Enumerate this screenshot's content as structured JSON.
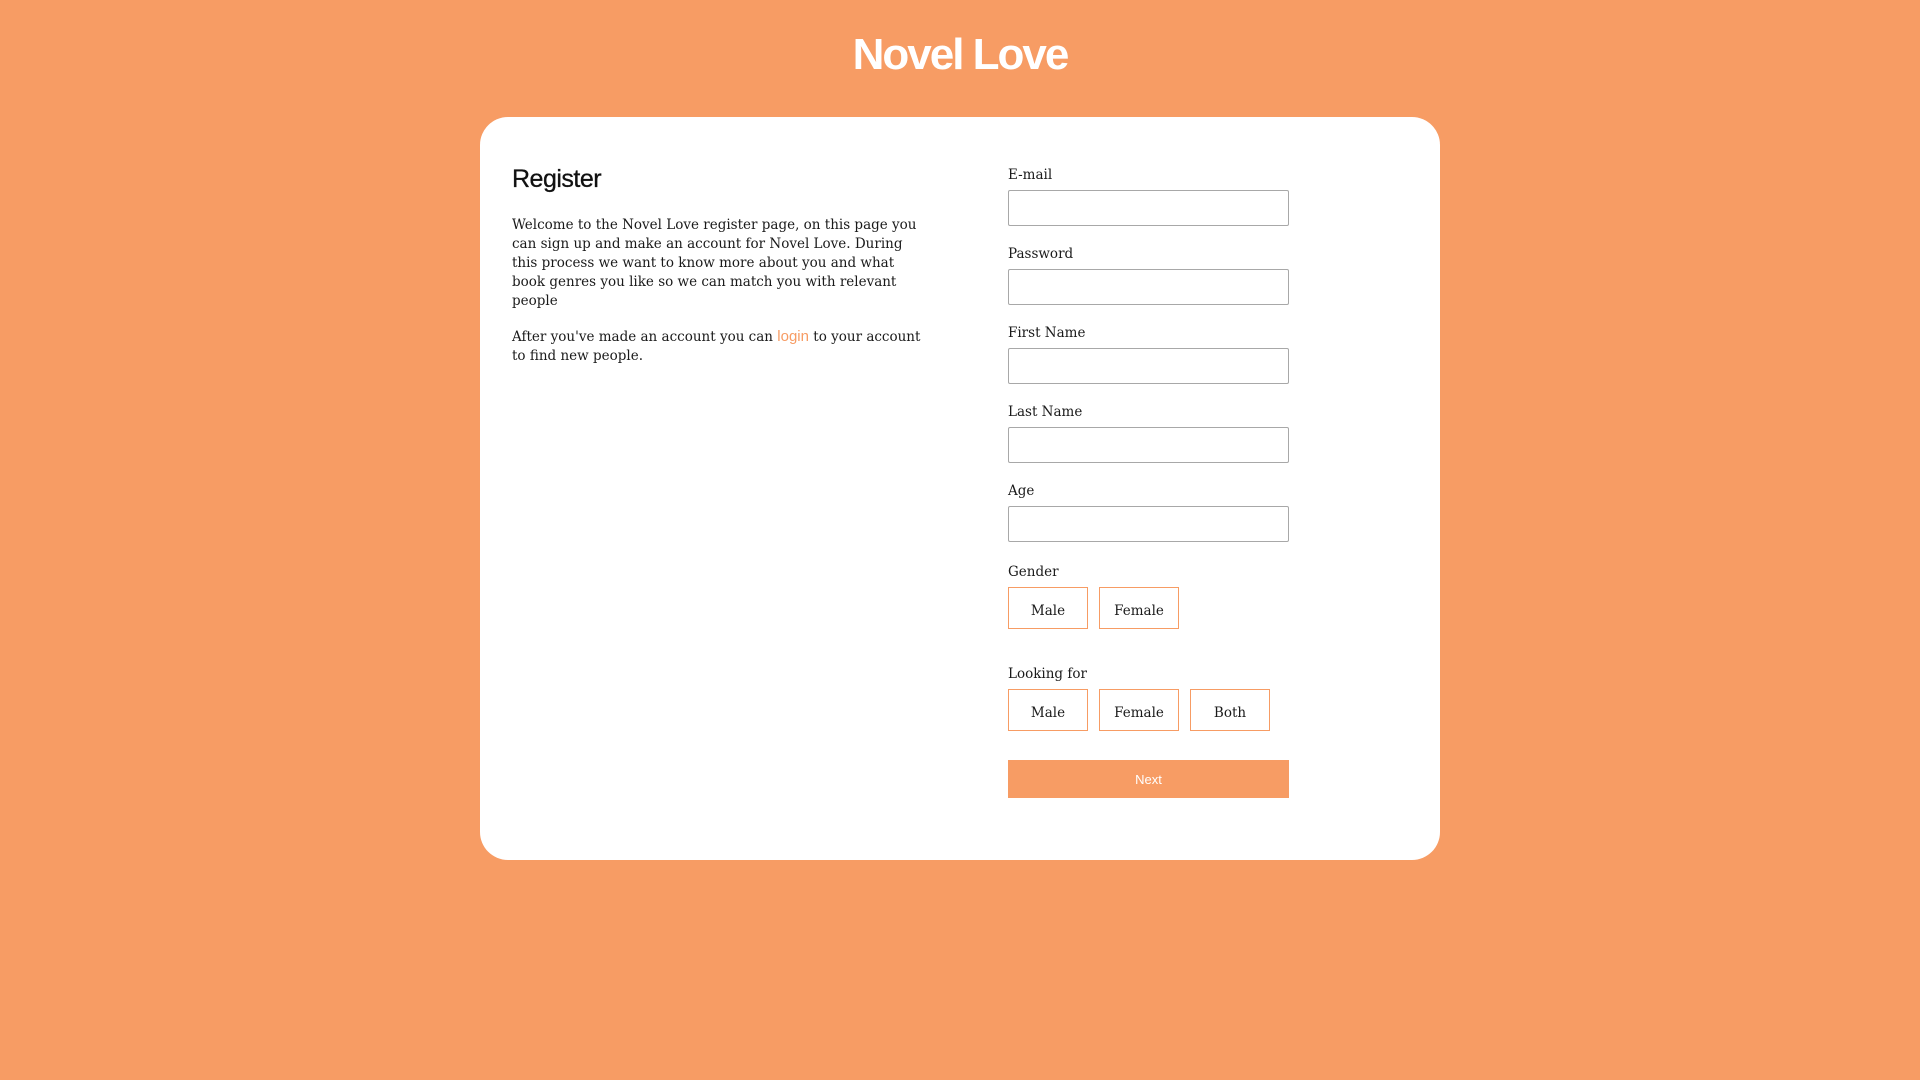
{
  "header": {
    "title": "Novel Love"
  },
  "intro": {
    "heading": "Register",
    "paragraph1": "Welcome to the Novel Love register page, on this page you can sign up and make an account for Novel Love. During this process we want to know more about you and what book genres you like so we can match you with relevant people",
    "paragraph2_before": "After you've made an account you can ",
    "paragraph2_link": "login",
    "paragraph2_after": " to your account to find new people."
  },
  "form": {
    "email_label": "E-mail",
    "email_value": "",
    "password_label": "Password",
    "password_value": "",
    "first_name_label": "First Name",
    "first_name_value": "",
    "last_name_label": "Last Name",
    "last_name_value": "",
    "age_label": "Age",
    "age_value": "",
    "gender_label": "Gender",
    "gender_options": [
      "Male",
      "Female"
    ],
    "looking_for_label": "Looking for",
    "looking_for_options": [
      "Male",
      "Female",
      "Both"
    ],
    "next_label": "Next"
  },
  "colors": {
    "accent": "#F79C64",
    "card": "#FFFFFF",
    "text": "#1A1A1A"
  }
}
